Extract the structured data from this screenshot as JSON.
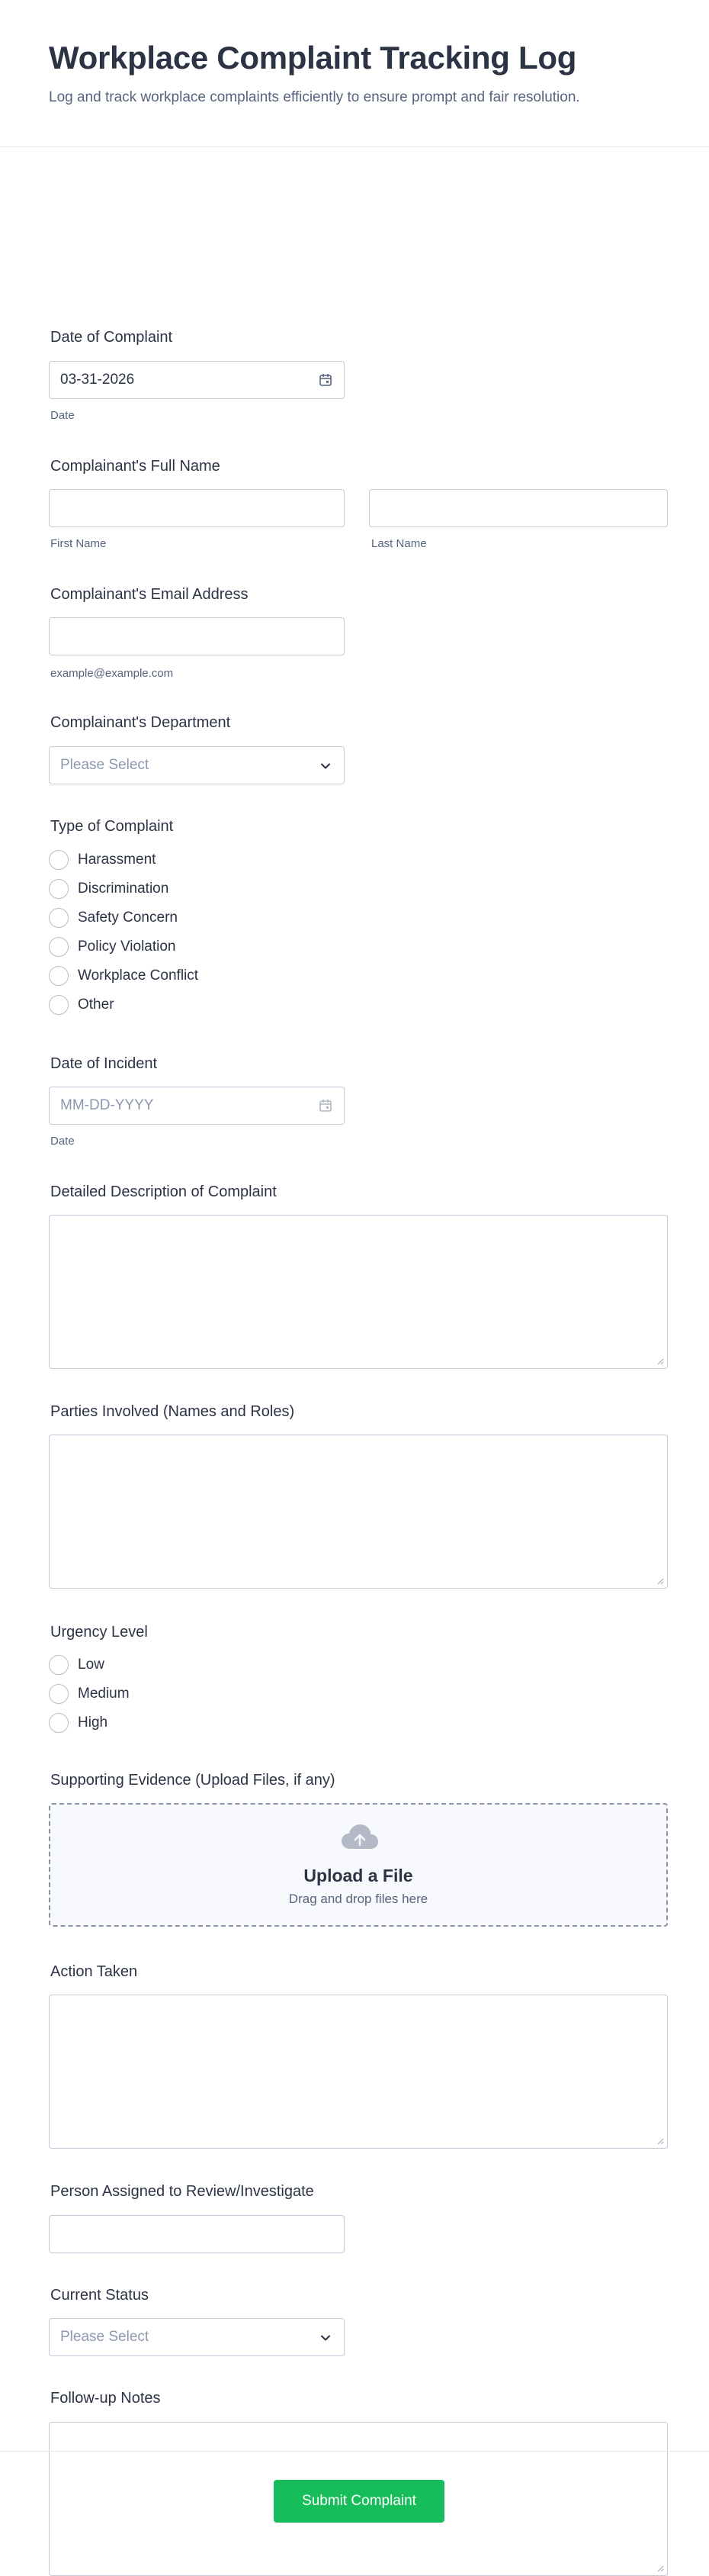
{
  "header": {
    "title": "Workplace Complaint Tracking Log",
    "subtitle": "Log and track workplace complaints efficiently to ensure prompt and fair resolution."
  },
  "date_of_complaint": {
    "label": "Date of Complaint",
    "value": "03-31-2026",
    "sublabel": "Date",
    "icon": "calendar-icon"
  },
  "full_name": {
    "label": "Complainant's Full Name",
    "first_sublabel": "First Name",
    "last_sublabel": "Last Name",
    "first_value": "",
    "last_value": ""
  },
  "email": {
    "label": "Complainant's Email Address",
    "value": "",
    "sublabel": "example@example.com"
  },
  "department": {
    "label": "Complainant's Department",
    "placeholder": "Please Select",
    "icon": "chevron-down-icon"
  },
  "complaint_type": {
    "label": "Type of Complaint",
    "options": [
      "Harassment",
      "Discrimination",
      "Safety Concern",
      "Policy Violation",
      "Workplace Conflict",
      "Other"
    ]
  },
  "date_of_incident": {
    "label": "Date of Incident",
    "placeholder": "MM-DD-YYYY",
    "sublabel": "Date",
    "icon": "calendar-icon"
  },
  "description": {
    "label": "Detailed Description of Complaint",
    "value": ""
  },
  "parties": {
    "label": "Parties Involved (Names and Roles)",
    "value": ""
  },
  "urgency": {
    "label": "Urgency Level",
    "options": [
      "Low",
      "Medium",
      "High"
    ]
  },
  "evidence": {
    "label": "Supporting Evidence (Upload Files, if any)",
    "upload_title": "Upload a File",
    "upload_sub": "Drag and drop files here",
    "icon": "cloud-upload-icon"
  },
  "action": {
    "label": "Action Taken",
    "value": ""
  },
  "assigned": {
    "label": "Person Assigned to Review/Investigate",
    "value": ""
  },
  "status": {
    "label": "Current Status",
    "placeholder": "Please Select",
    "icon": "chevron-down-icon"
  },
  "followup": {
    "label": "Follow-up Notes",
    "value": ""
  },
  "submit": {
    "label": "Submit Complaint"
  },
  "colors": {
    "accent": "#18bd5b",
    "text": "#2c3345",
    "muted": "#57647e",
    "border": "#c3cad8"
  }
}
